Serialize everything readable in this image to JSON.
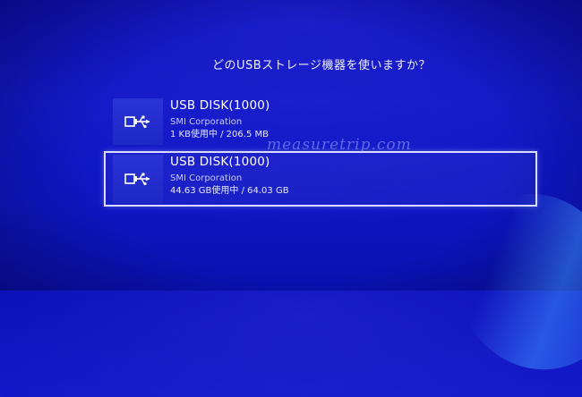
{
  "dialog": {
    "title": "どのUSBストレージ機器を使いますか？"
  },
  "devices": [
    {
      "name": "USB DISK(1000)",
      "vendor": "SMI Corporation",
      "usage": "1 KB使用中 / 206.5 MB",
      "icon": "usb-icon",
      "selected": false
    },
    {
      "name": "USB DISK(1000)",
      "vendor": "SMI Corporation",
      "usage": "44.63 GB使用中 / 64.03 GB",
      "icon": "usb-icon",
      "selected": true
    }
  ],
  "watermark": "measuretrip.com",
  "colors": {
    "background": "#1218c9",
    "tile": "#2a34d6",
    "selection_border": "#d9dcff",
    "text": "#ffffff",
    "subtext": "#c9cdfb"
  }
}
